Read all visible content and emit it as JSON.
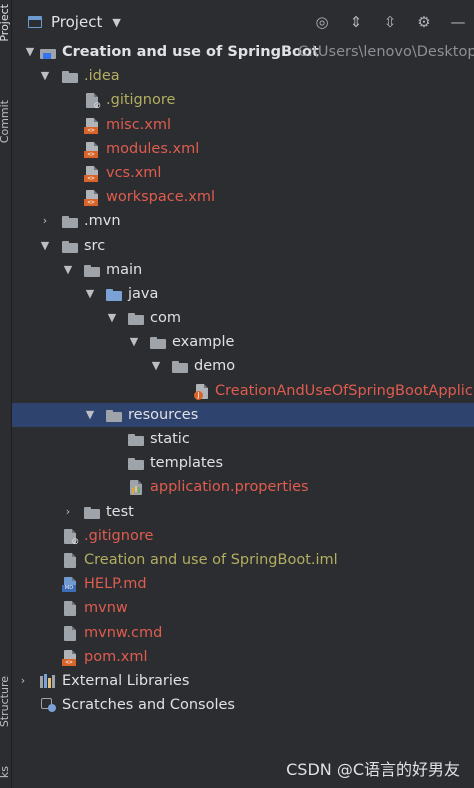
{
  "side_tabs": {
    "project": "Project",
    "commit": "Commit",
    "structure": "Structure",
    "bookmarks": "ks"
  },
  "toolbar": {
    "title": "Project"
  },
  "tree": {
    "root": {
      "label": "Creation and use of SpringBoot",
      "path": "C:\\Users\\lenovo\\Desktop"
    },
    "idea": ".idea",
    "idea_files": [
      ".gitignore",
      "misc.xml",
      "modules.xml",
      "vcs.xml",
      "workspace.xml"
    ],
    "mvn": ".mvn",
    "src": "src",
    "main": "main",
    "java": "java",
    "com": "com",
    "example": "example",
    "demo": "demo",
    "app_class": "CreationAndUseOfSpringBootApplic",
    "resources": "resources",
    "static": "static",
    "templates": "templates",
    "app_props": "application.properties",
    "test": "test",
    "root_files": [
      ".gitignore",
      "Creation and use of SpringBoot.iml",
      "HELP.md",
      "mvnw",
      "mvnw.cmd",
      "pom.xml"
    ],
    "external_libraries": "External Libraries",
    "scratches": "Scratches and Consoles"
  },
  "watermark": "CSDN @C语言的好男友"
}
